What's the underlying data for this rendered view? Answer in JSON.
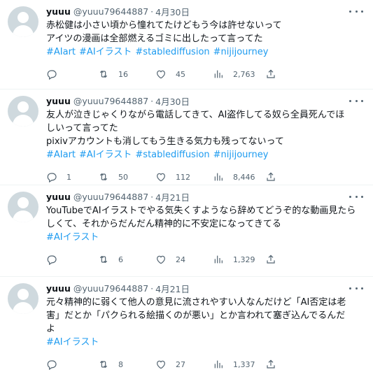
{
  "tweets": [
    {
      "author_name": "yuuu",
      "handle": "@yuuu79644887",
      "separator": "·",
      "date": "4月30日",
      "lines": [
        "赤松健は小さい頃から憧れてたけどもう今は許せないって",
        "アイツの漫画は全部燃えるゴミに出したって言ってた"
      ],
      "hashtags": [
        "#AIart",
        "#AIイラスト",
        "#stablediffusion",
        "#nijijourney"
      ],
      "replies": "",
      "retweets": "16",
      "likes": "45",
      "views": "2,763"
    },
    {
      "author_name": "yuuu",
      "handle": "@yuuu79644887",
      "separator": "·",
      "date": "4月30日",
      "lines": [
        "友人が泣きじゃくりながら電話してきて、AI盗作してる奴ら全員死んでほ",
        "しいって言ってた",
        "pixivアカウントも消してもう生きる気力も残ってないって"
      ],
      "hashtags": [
        "#AIart",
        "#AIイラスト",
        "#stablediffusion",
        "#nijijourney"
      ],
      "replies": "1",
      "retweets": "50",
      "likes": "112",
      "views": "8,446"
    },
    {
      "author_name": "yuuu",
      "handle": "@yuuu79644887",
      "separator": "·",
      "date": "4月21日",
      "lines": [
        "YouTubeでAIイラストでやる気失くすようなら辞めてどうぞ的な動画見たら",
        "しくて、それからだんだん精神的に不安定になってきてる"
      ],
      "hashtags": [
        "#AIイラスト"
      ],
      "replies": "",
      "retweets": "6",
      "likes": "24",
      "views": "1,329"
    },
    {
      "author_name": "yuuu",
      "handle": "@yuuu79644887",
      "separator": "·",
      "date": "4月21日",
      "lines": [
        "元々精神的に弱くて他人の意見に流されやすい人なんだけど「AI否定は老",
        "害」だとか「パクられる絵描くのが悪い」とか言われて塞ぎ込んでるんだ",
        "よ"
      ],
      "hashtags": [
        "#AIイラスト"
      ],
      "replies": "",
      "retweets": "8",
      "likes": "27",
      "views": "1,337"
    }
  ],
  "icons": {
    "avatar": "default-avatar-icon",
    "more": "more-icon",
    "reply": "reply-icon",
    "retweet": "retweet-icon",
    "like": "heart-icon",
    "views": "views-icon",
    "share": "share-icon"
  },
  "colors": {
    "text": "#0f1419",
    "muted": "#536471",
    "link": "#1d9bf0",
    "avatar_bg": "#cfd9de",
    "divider": "#eff3f4"
  }
}
